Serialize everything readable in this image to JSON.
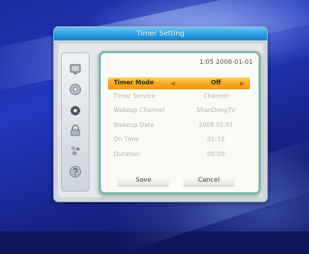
{
  "window": {
    "title": "Timer Setting"
  },
  "sidebar": {
    "icons": [
      {
        "name": "tv-screen-icon"
      },
      {
        "name": "disc-icon"
      },
      {
        "name": "settings-gear-icon"
      },
      {
        "name": "lock-icon"
      },
      {
        "name": "dots-icon"
      },
      {
        "name": "help-icon"
      }
    ]
  },
  "dialog": {
    "datetime": "1:05 2008-01-01",
    "rows": [
      {
        "label": "Timer Mode",
        "value": "Off",
        "selected": true
      },
      {
        "label": "Timer Service",
        "value": "Channel",
        "selected": false
      },
      {
        "label": "Wakeup Channel",
        "value": "ShanDongTV",
        "selected": false
      },
      {
        "label": "Wakeup Date",
        "value": "2008.01.01",
        "selected": false
      },
      {
        "label": "On Time",
        "value": "01:10",
        "selected": false
      },
      {
        "label": "Duration",
        "value": "00:00",
        "selected": false
      }
    ],
    "buttons": {
      "save_label": "Save",
      "cancel_label": "Cancel"
    },
    "arrows": {
      "left": "◀",
      "right": "▶"
    }
  },
  "colors": {
    "accent": "#f6a623",
    "title_bar": "#2a9be0",
    "dialog_border": "#79b9a6",
    "background": "#1a2590"
  }
}
